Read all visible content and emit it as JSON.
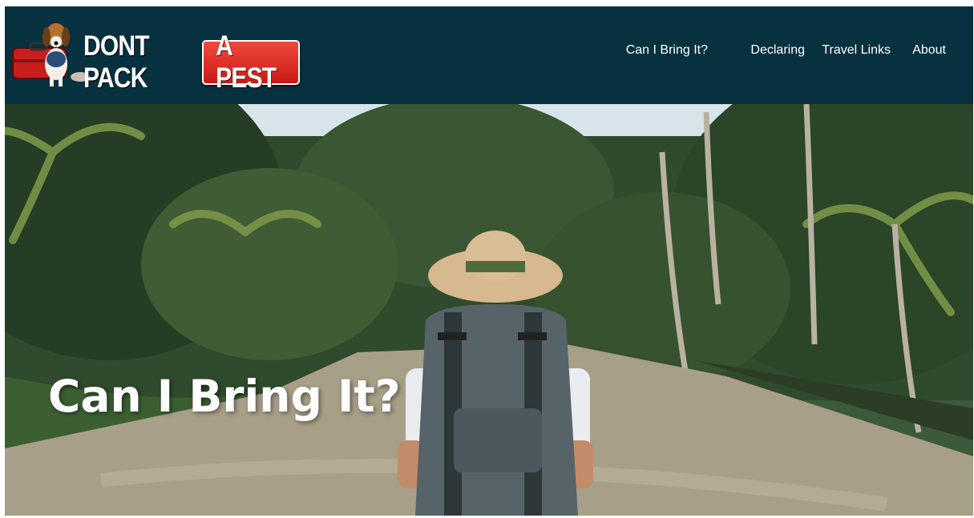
{
  "brand": {
    "logo_text_1": "DONT PACK",
    "logo_text_2": "A PEST"
  },
  "nav": {
    "items": [
      {
        "label": "Can I Bring It?"
      },
      {
        "label": "Declaring"
      },
      {
        "label": "Travel Links"
      },
      {
        "label": "About"
      }
    ]
  },
  "hero": {
    "title": "Can I Bring It?"
  },
  "colors": {
    "header_bg": "#08313f",
    "badge_red": "#d9241b",
    "text": "#ffffff"
  }
}
